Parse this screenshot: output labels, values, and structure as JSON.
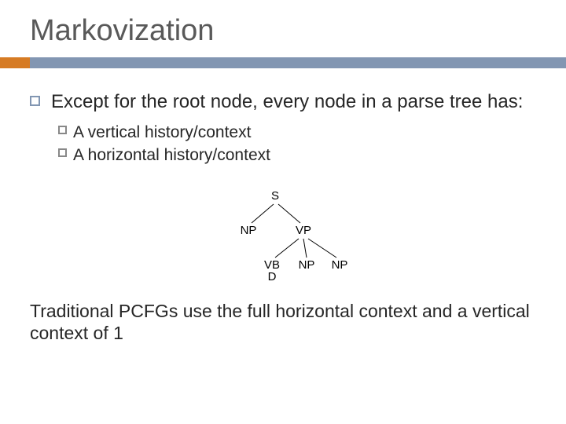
{
  "title": "Markovization",
  "main_bullet": "Except for the root node, every node in a parse tree has:",
  "sub_bullets": [
    "A vertical history/context",
    "A horizontal history/context"
  ],
  "tree": {
    "root": "S",
    "level1": [
      "NP",
      "VP"
    ],
    "level2": [
      "VBD",
      "NP",
      "NP"
    ]
  },
  "footer": "Traditional PCFGs use the full horizontal context and a vertical context of 1"
}
